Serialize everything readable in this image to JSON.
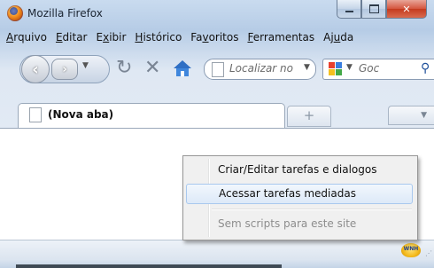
{
  "window": {
    "title": "Mozilla Firefox"
  },
  "menubar": {
    "items": [
      {
        "pre": "",
        "key": "A",
        "post": "rquivo"
      },
      {
        "pre": "",
        "key": "E",
        "post": "ditar"
      },
      {
        "pre": "E",
        "key": "x",
        "post": "ibir"
      },
      {
        "pre": "",
        "key": "H",
        "post": "istórico"
      },
      {
        "pre": "Fa",
        "key": "v",
        "post": "oritos"
      },
      {
        "pre": "",
        "key": "F",
        "post": "erramentas"
      },
      {
        "pre": "Aj",
        "key": "u",
        "post": "da"
      }
    ]
  },
  "toolbar": {
    "url_placeholder": "Localizar no",
    "search_placeholder": "Goc"
  },
  "tabs": {
    "active_label": "(Nova aba)"
  },
  "context_menu": {
    "items": [
      {
        "label": "Criar/Editar tarefas e dialogos",
        "state": "normal"
      },
      {
        "label": "Acessar tarefas mediadas",
        "state": "hover"
      },
      {
        "label": "Sem scripts para este site",
        "state": "disabled"
      }
    ]
  },
  "statusbar": {
    "icon_text": "WNH"
  },
  "colors": {
    "frame_top": "#c9dbef",
    "menu_hover_border": "#a8c8ee",
    "close_button": "#c43a1f"
  }
}
